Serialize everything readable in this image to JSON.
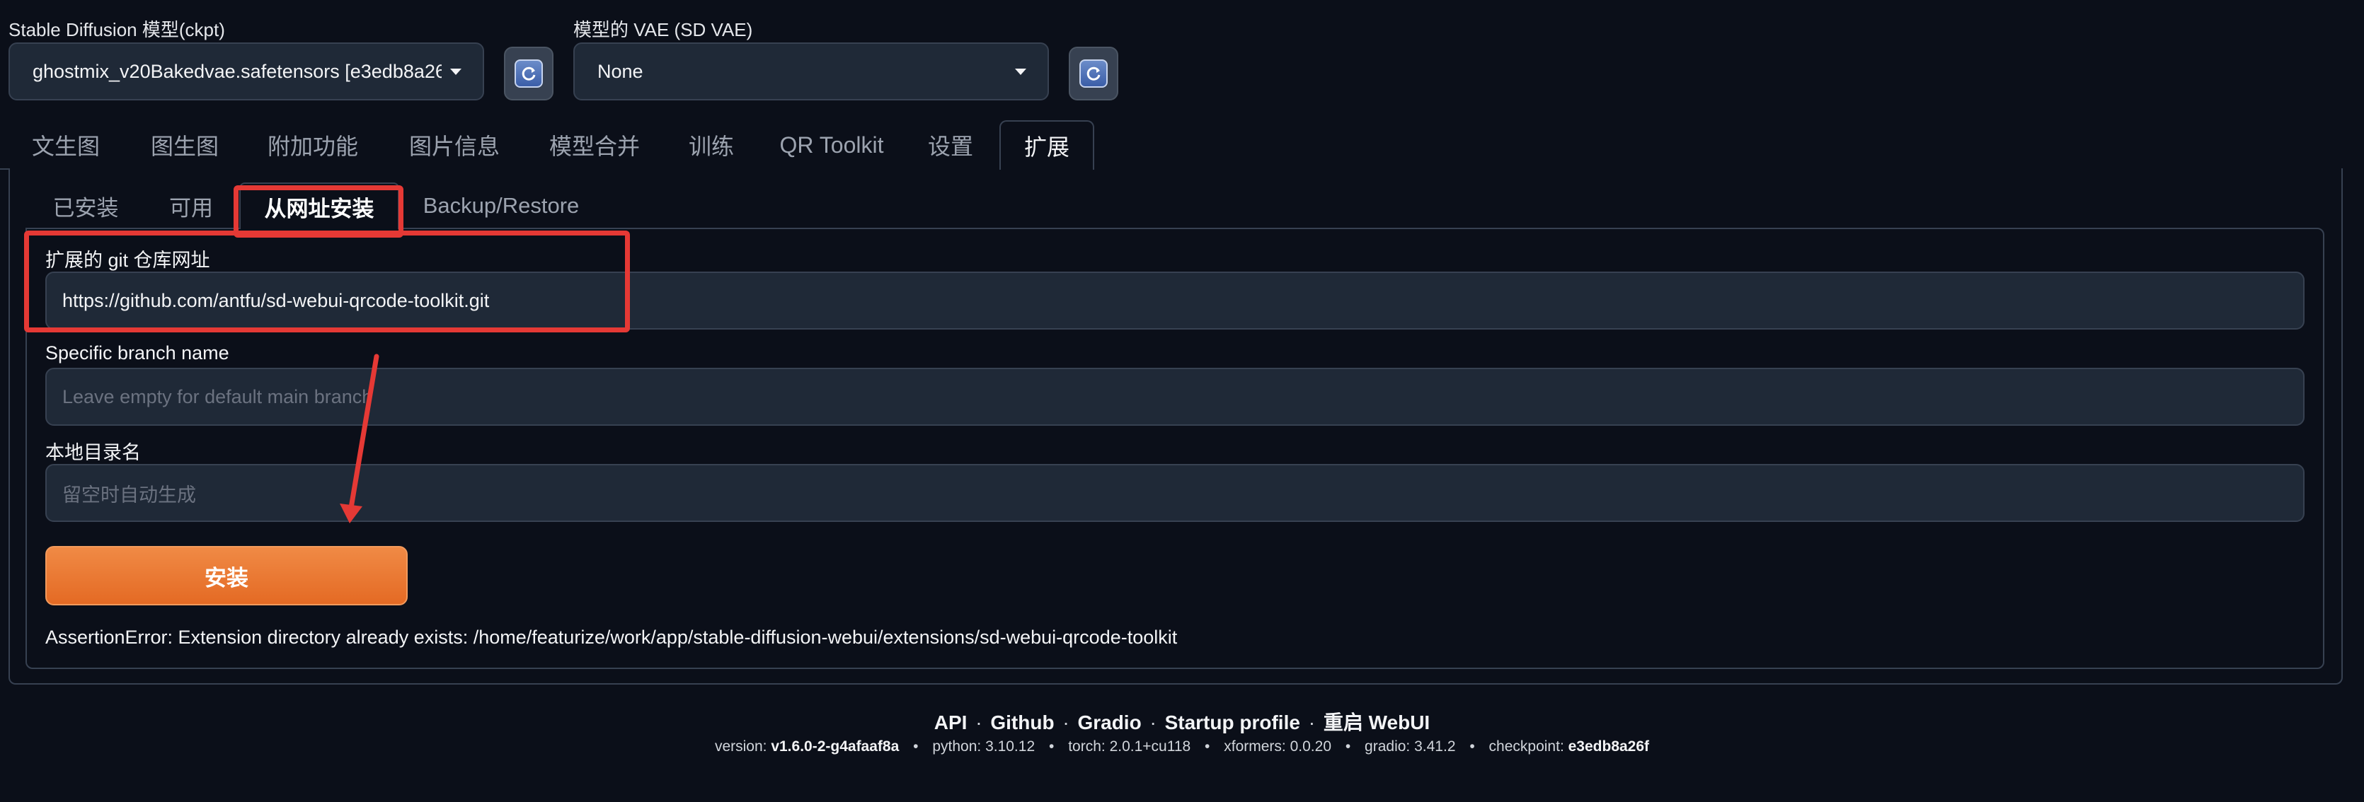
{
  "header": {
    "model_label": "Stable Diffusion 模型(ckpt)",
    "model_value": "ghostmix_v20Bakedvae.safetensors [e3edb8a26",
    "vae_label": "模型的 VAE (SD VAE)",
    "vae_value": "None"
  },
  "main_tabs": [
    {
      "label": "文生图"
    },
    {
      "label": "图生图"
    },
    {
      "label": "附加功能"
    },
    {
      "label": "图片信息"
    },
    {
      "label": "模型合并"
    },
    {
      "label": "训练"
    },
    {
      "label": "QR Toolkit"
    },
    {
      "label": "设置"
    },
    {
      "label": "扩展",
      "active": true
    }
  ],
  "sub_tabs": [
    {
      "label": "已安装"
    },
    {
      "label": "可用"
    },
    {
      "label": "从网址安装",
      "active": true
    },
    {
      "label": "Backup/Restore"
    }
  ],
  "form": {
    "git_url_label": "扩展的 git 仓库网址",
    "git_url_value": "https://github.com/antfu/sd-webui-qrcode-toolkit.git",
    "branch_label": "Specific branch name",
    "branch_placeholder": "Leave empty for default main branch",
    "dir_label": "本地目录名",
    "dir_placeholder": "留空时自动生成",
    "install_label": "安装",
    "result_text": "AssertionError: Extension directory already exists: /home/featurize/work/app/stable-diffusion-webui/extensions/sd-webui-qrcode-toolkit"
  },
  "footer": {
    "links": [
      "API",
      "Github",
      "Gradio",
      "Startup profile",
      "重启 WebUI"
    ],
    "separator": "·",
    "versions": [
      {
        "label": "version:",
        "value": "v1.6.0-2-g4afaaf8a"
      },
      {
        "label": "python:",
        "value": "3.10.12"
      },
      {
        "label": "torch:",
        "value": "2.0.1+cu118"
      },
      {
        "label": "xformers:",
        "value": "0.0.20"
      },
      {
        "label": "gradio:",
        "value": "3.41.2"
      },
      {
        "label": "checkpoint:",
        "value": "e3edb8a26f"
      }
    ],
    "version_dot": "•"
  },
  "colors": {
    "background": "#0b0f19",
    "accent": "#e46a24",
    "highlight": "#e53935"
  },
  "icons": {
    "refresh": "refresh-icon",
    "dropdown": "chevron-down-icon"
  }
}
